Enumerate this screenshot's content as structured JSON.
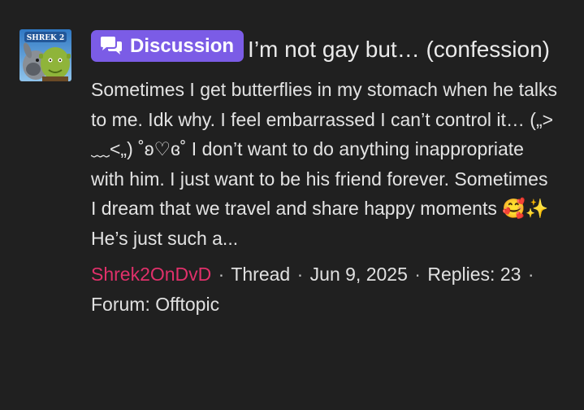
{
  "thread": {
    "avatar_label": "SHREK 2",
    "prefix_label": "Discussion",
    "prefix_icon": "discussion-bubbles-icon",
    "title": "I’m not gay but… (confession)",
    "snippet": "Sometimes I get butterflies in my stomach when he talks to me. Idk why. I feel embarrassed I can’t control it… („>﹏<„) ˚ʚ♡ɞ˚ I don’t want to do anything inappropriate with him. I just want to be his friend forever. Sometimes I dream that we travel and share happy moments 🥰✨ He’s just such a...",
    "author": "Shrek2OnDvD",
    "type_label": "Thread",
    "date": "Jun 9, 2025",
    "replies_label": "Replies:",
    "replies_count": "23",
    "forum_label": "Forum:",
    "forum_name": "Offtopic"
  },
  "colors": {
    "background": "#202020",
    "badge": "#7b5ce6",
    "author": "#e0306a",
    "text": "#e3e3e3"
  }
}
